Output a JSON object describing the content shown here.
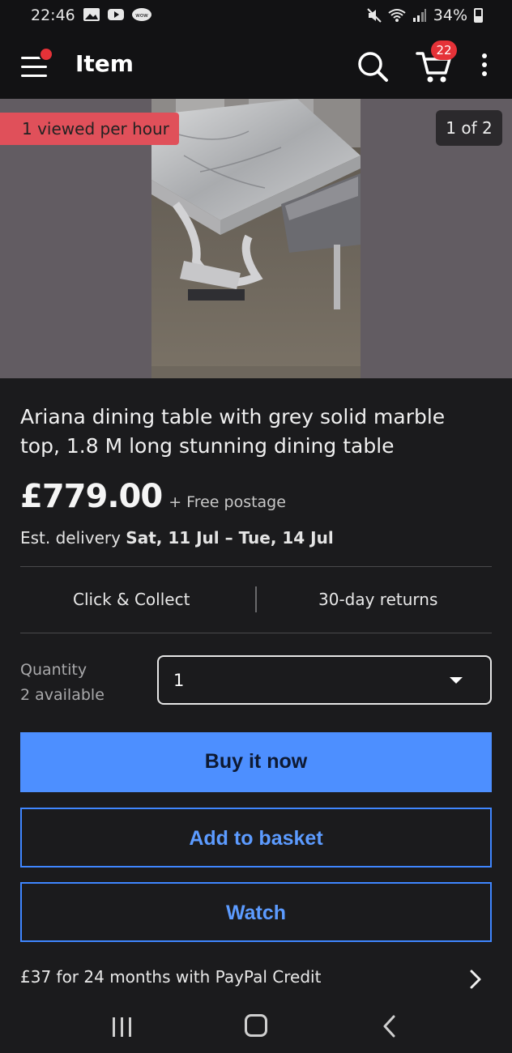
{
  "status_bar": {
    "time": "22:46",
    "battery": "34%",
    "icons": [
      "gallery-icon",
      "youtube-icon",
      "app-badge-icon",
      "mute-icon",
      "wifi-icon",
      "signal-icon",
      "battery-icon"
    ]
  },
  "app_bar": {
    "title": "Item",
    "cart_count": "22"
  },
  "gallery": {
    "viewed_badge": "1 viewed per hour",
    "counter": "1 of 2"
  },
  "item": {
    "title": "Ariana dining table with grey solid marble top, 1.8 M long stunning dining table",
    "price": "£779.00",
    "postage": "+ Free postage",
    "delivery_prefix": "Est. delivery ",
    "delivery_dates": "Sat, 11 Jul – Tue, 14 Jul"
  },
  "features": {
    "collect": "Click & Collect",
    "returns": "30-day returns"
  },
  "quantity": {
    "label": "Quantity",
    "available": "2 available",
    "selected": "1"
  },
  "actions": {
    "buy_now": "Buy it now",
    "add_to_basket": "Add to basket",
    "watch": "Watch"
  },
  "credit": {
    "text": "£37 for 24 months with PayPal Credit"
  },
  "colors": {
    "accent_blue": "#4d8fff",
    "badge_red": "#e53238",
    "background": "#1b1b1d"
  }
}
